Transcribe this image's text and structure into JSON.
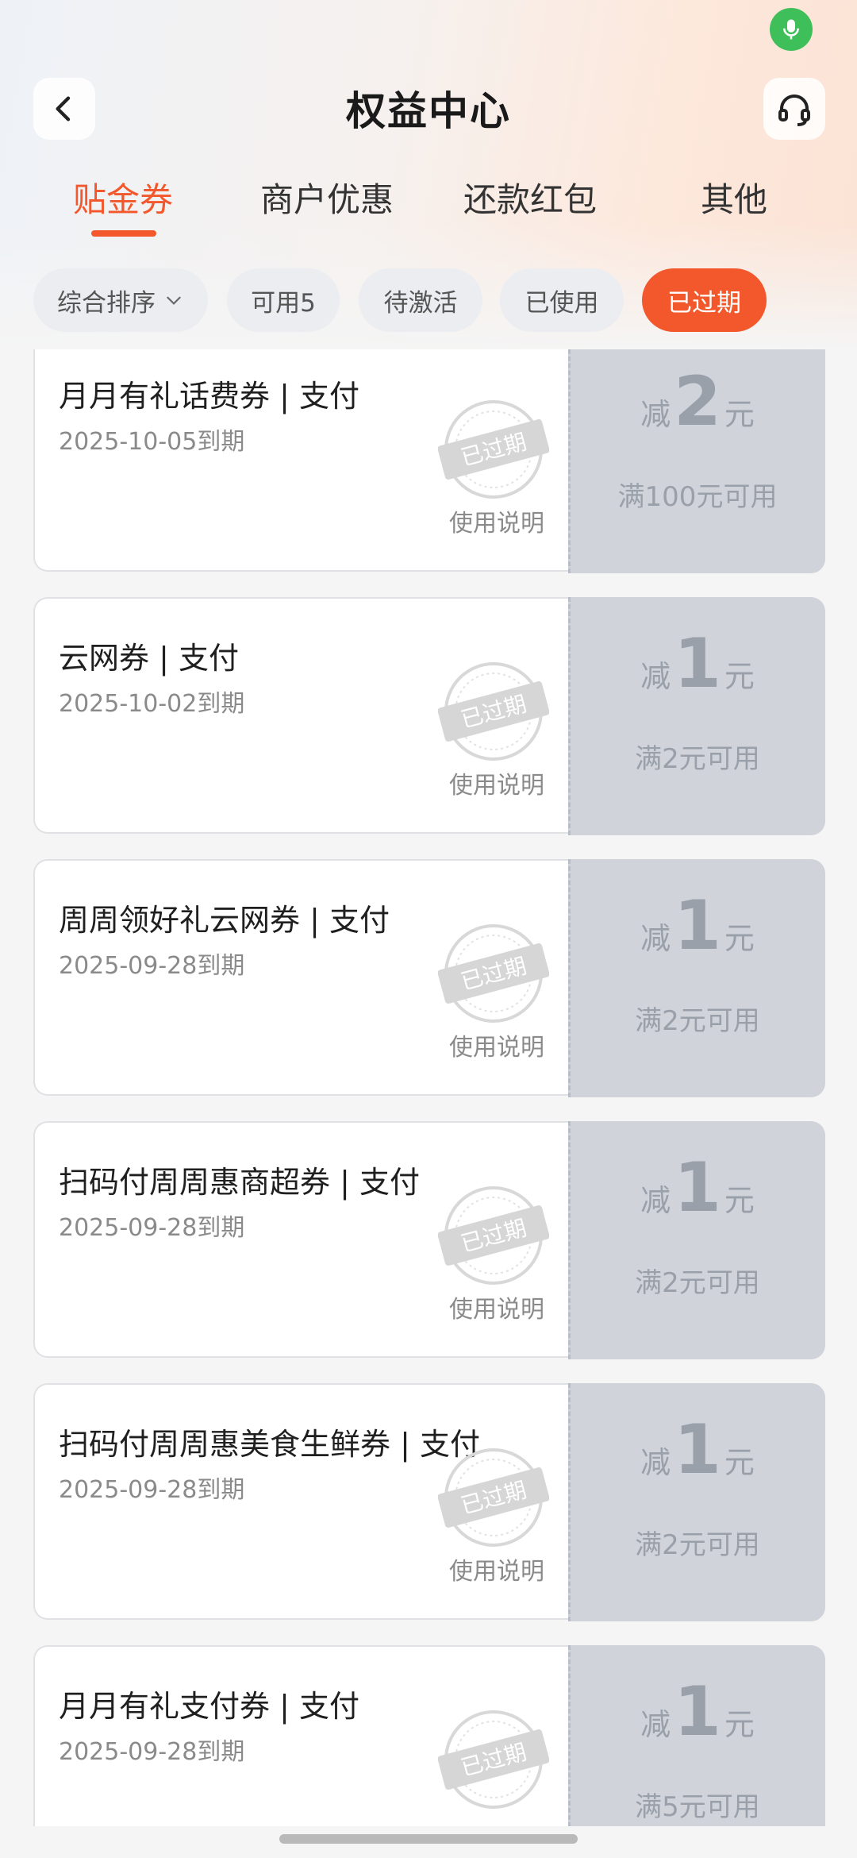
{
  "header": {
    "title": "权益中心",
    "back_icon": "chevron-left-icon",
    "service_icon": "headset-icon",
    "mic_icon": "microphone-icon",
    "mic_color": "#3fbf5a"
  },
  "tabs": [
    {
      "label": "贴金券",
      "active": true
    },
    {
      "label": "商户优惠",
      "active": false
    },
    {
      "label": "还款红包",
      "active": false
    },
    {
      "label": "其他",
      "active": false
    }
  ],
  "filters": [
    {
      "label": "综合排序",
      "active": false,
      "has_dropdown": true
    },
    {
      "label": "可用5",
      "active": false
    },
    {
      "label": "待激活",
      "active": false
    },
    {
      "label": "已使用",
      "active": false
    },
    {
      "label": "已过期",
      "active": true
    }
  ],
  "accent_color": "#f2582c",
  "coupons": [
    {
      "name": "月月有礼话费券 | 支付",
      "expiry": "2025-10-05到期",
      "link": "使用说明",
      "stamp": "已过期",
      "prefix": "减",
      "amount": "2",
      "unit": "元",
      "condition": "满100元可用"
    },
    {
      "name": "云网券 | 支付",
      "expiry": "2025-10-02到期",
      "link": "使用说明",
      "stamp": "已过期",
      "prefix": "减",
      "amount": "1",
      "unit": "元",
      "condition": "满2元可用"
    },
    {
      "name": "周周领好礼云网券 | 支付",
      "expiry": "2025-09-28到期",
      "link": "使用说明",
      "stamp": "已过期",
      "prefix": "减",
      "amount": "1",
      "unit": "元",
      "condition": "满2元可用"
    },
    {
      "name": "扫码付周周惠商超券 | 支付",
      "expiry": "2025-09-28到期",
      "link": "使用说明",
      "stamp": "已过期",
      "prefix": "减",
      "amount": "1",
      "unit": "元",
      "condition": "满2元可用"
    },
    {
      "name": "扫码付周周惠美食生鲜券 | 支付",
      "expiry": "2025-09-28到期",
      "link": "使用说明",
      "stamp": "已过期",
      "prefix": "减",
      "amount": "1",
      "unit": "元",
      "condition": "满2元可用"
    },
    {
      "name": "月月有礼支付券 | 支付",
      "expiry": "2025-09-28到期",
      "link": "",
      "stamp": "已过期",
      "prefix": "减",
      "amount": "1",
      "unit": "元",
      "condition": "满5元可用"
    }
  ]
}
